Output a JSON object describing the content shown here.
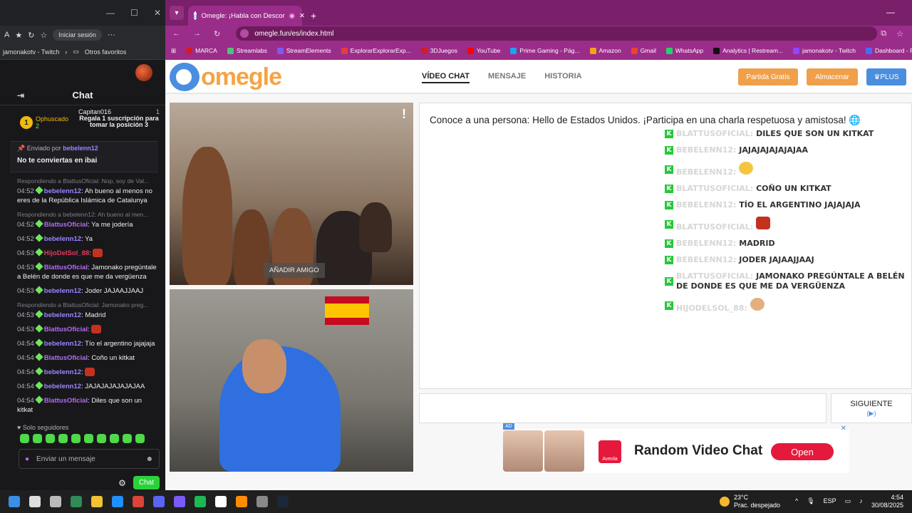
{
  "left_window": {
    "toolbar": {
      "session_label": "Iniciar sesión",
      "more": "···"
    },
    "bookmarks": {
      "twitch": "jamonakotv - Twitch",
      "other": "Otros favoritos"
    },
    "chat_title": "Chat",
    "ranks": [
      {
        "name": "Ophuscado",
        "count": "2",
        "badge": "1"
      },
      {
        "name": "Capitan016",
        "count": "1",
        "note": "Regala 1 suscripción para tomar la posición 3"
      }
    ],
    "pinned": {
      "by_prefix": "Enviado por",
      "by_user": "bebelenn12",
      "text": "No te conviertas en ibai"
    },
    "messages": [
      {
        "reply": "Respondiendo a BlattusOficial: Nop, soy de Val...",
        "time": "04:52",
        "user": "bebelenn12",
        "ucls": "u-g",
        "text": "Ah bueno al menos no eres de la República Islámica de Catalunya"
      },
      {
        "reply": "Respondiendo a bebelenn12: Ah bueno al men...",
        "time": "04:52",
        "user": "BlattusOficial",
        "ucls": "u-p",
        "text": "Ya me jodería"
      },
      {
        "time": "04:52",
        "user": "bebelenn12",
        "ucls": "u-g",
        "text": "Ya"
      },
      {
        "time": "04:53",
        "user": "HijoDelSol_88",
        "ucls": "u-r",
        "text": ""
      },
      {
        "time": "04:53",
        "user": "BlattusOficial",
        "ucls": "u-p",
        "text": "Jamonako pregúntale a Belén de donde es que me da vergüenza"
      },
      {
        "time": "04:53",
        "user": "bebelenn12",
        "ucls": "u-g",
        "text": "Joder JAJAAJJAAJ"
      },
      {
        "reply": "Respondiendo a BlattusOficial: Jamonako preg...",
        "time": "04:53",
        "user": "bebelenn12",
        "ucls": "u-g",
        "text": "Madrid"
      },
      {
        "time": "04:53",
        "user": "BlattusOficial",
        "ucls": "u-p",
        "text": ""
      },
      {
        "time": "04:54",
        "user": "bebelenn12",
        "ucls": "u-g",
        "text": "Tío el argentino jajajaja"
      },
      {
        "time": "04:54",
        "user": "BlattusOficial",
        "ucls": "u-p",
        "text": "Coño un kitkat"
      },
      {
        "time": "04:54",
        "user": "bebelenn12",
        "ucls": "u-g",
        "text": ""
      },
      {
        "time": "04:54",
        "user": "bebelenn12",
        "ucls": "u-g",
        "text": "JAJAJAJAJAJAJAA"
      },
      {
        "time": "04:54",
        "user": "BlattusOficial",
        "ucls": "u-p",
        "text": "Diles que son un kitkat"
      }
    ],
    "solo": "Solo seguidores",
    "input_placeholder": "Enviar un mensaje",
    "chat_button": "Chat"
  },
  "browser": {
    "tab_title": "Omegle: ¡Habla con Descor",
    "url": "omegle.fun/es/index.html",
    "bookmarks": [
      "MARCA",
      "Streamlabs",
      "StreamElements",
      "ExplorarExplorarExp...",
      "3DJuegos",
      "YouTube",
      "Prime Gaming - Pág...",
      "Amazon",
      "Gmail",
      "WhatsApp",
      "Analytics | Restream...",
      "jamonakotv - Twitch",
      "Dashboard - Restre..."
    ],
    "bookmark_colors": [
      "#d31b2a",
      "#53c17a",
      "#7b5cf0",
      "#e23d3d",
      "#d31b2a",
      "#ff0000",
      "#1da1f2",
      "#f3a317",
      "#ea4335",
      "#25d366",
      "#111111",
      "#9146ff",
      "#4a6cf7"
    ]
  },
  "omegle": {
    "logo_text": "omegle",
    "nav": [
      "VÍDEO CHAT",
      "MENSAJE",
      "HISTORIA"
    ],
    "btn_free": "Partida Gratis",
    "btn_store": "Almacenar",
    "btn_plus": "PLUS",
    "add_friend": "AÑADIR AMIGO",
    "intro": "Conoce a una persona: Hello de Estados Unidos. ¡Participa en una charla respetuosa y amistosa!",
    "overlay": [
      {
        "name": "BLATTUSOFICIAL:",
        "text": "DILES QUE SON UN KITKAT"
      },
      {
        "name": "BEBELENN12:",
        "text": "JAJAJAJAJAJAJAA"
      },
      {
        "name": "BEBELENN12:",
        "text": "",
        "emote": "lol"
      },
      {
        "name": "BLATTUSOFICIAL:",
        "text": "COÑO UN KITKAT"
      },
      {
        "name": "BEBELENN12:",
        "text": "TÍO EL ARGENTINO JAJAJAJA"
      },
      {
        "name": "BLATTUSOFICIAL:",
        "text": "",
        "emote": "red"
      },
      {
        "name": "BEBELENN12:",
        "text": "MADRID"
      },
      {
        "name": "BEBELENN12:",
        "text": "JODER JAJAAJJAAJ"
      },
      {
        "name": "BLATTUSOFICIAL:",
        "text": "JAMONAKO PREGÚNTALE A BELÉN DE DONDE ES QUE ME DA VERGÜENZA"
      },
      {
        "name": "HIJODELSOL_88:",
        "text": "",
        "emote": "face"
      }
    ],
    "next_label": "SIGUIENTE",
    "next_sub": "(▶)",
    "ad": {
      "tag": "AD",
      "brand": "Aveola",
      "title": "Random Video Chat",
      "cta": "Open",
      "close": "✕"
    }
  },
  "taskbar": {
    "icon_colors": [
      "#3a8ee6",
      "#dddddd",
      "#bbbbbb",
      "#2e8b57",
      "#f1c232",
      "#1e90ff",
      "#db4437",
      "#5865f2",
      "#7a5af8",
      "#1db954",
      "#ffffff",
      "#ff8c00",
      "#888888",
      "#1b2838"
    ],
    "temp": "23°C",
    "weather": "Prac. despejado",
    "lang": "ESP",
    "time": "4:54",
    "date": "30/08/2025"
  }
}
